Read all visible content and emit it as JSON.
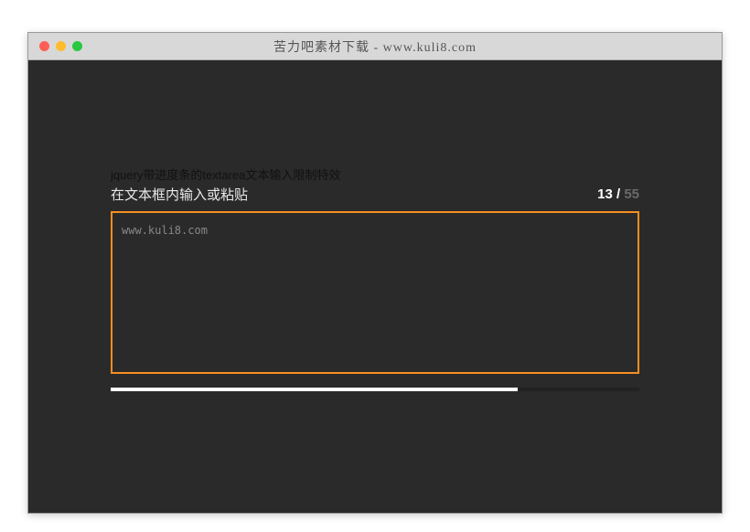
{
  "window": {
    "title": "苦力吧素材下载 - www.kuli8.com"
  },
  "content": {
    "description": "jquery带进度条的textarea文本输入限制特效",
    "label": "在文本框内输入或粘贴",
    "counter": {
      "current": "13",
      "separator": " / ",
      "max": "55"
    },
    "textarea": {
      "value": "www.kuli8.com",
      "placeholder": ""
    },
    "progress": {
      "percent": 77
    }
  }
}
